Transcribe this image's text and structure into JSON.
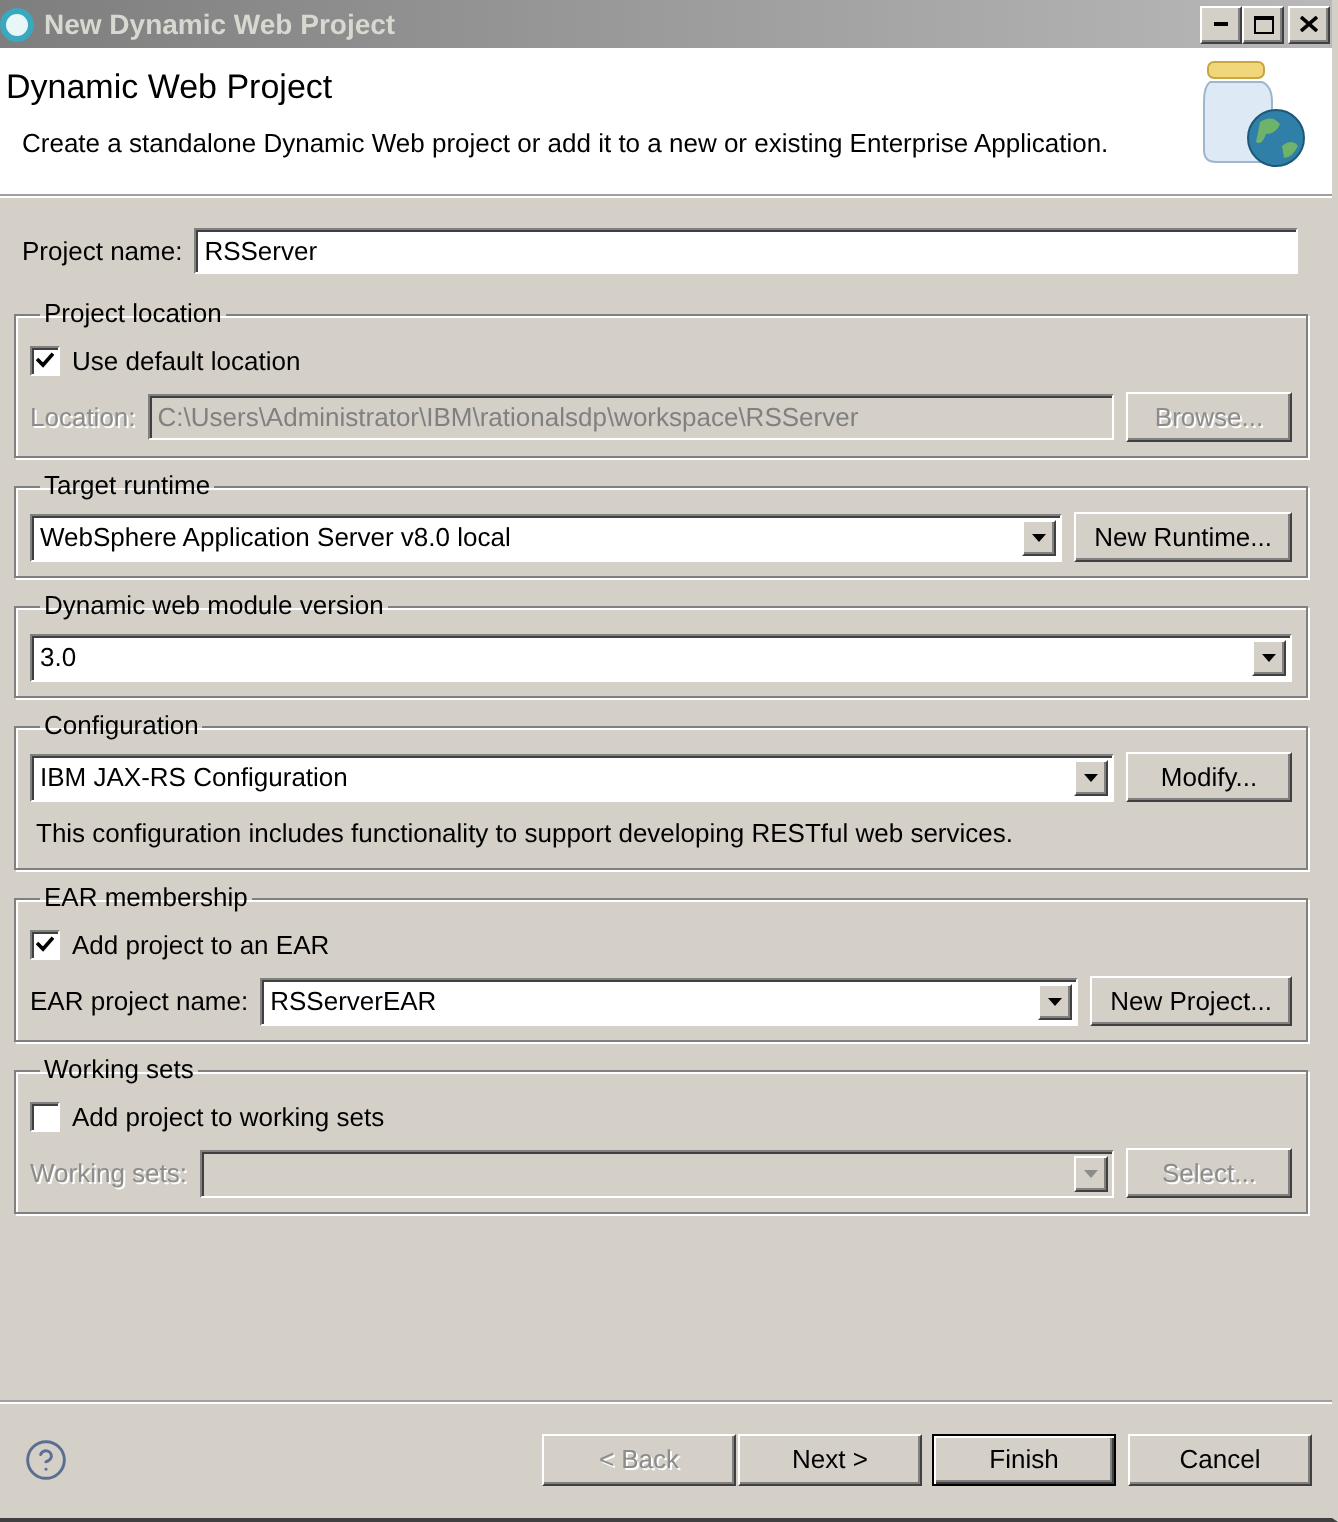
{
  "window": {
    "title": "New Dynamic Web Project"
  },
  "header": {
    "title": "Dynamic Web Project",
    "description": "Create a standalone Dynamic Web project or add it to a new or existing Enterprise Application."
  },
  "project_name": {
    "label": "Project name:",
    "value": "RSServer"
  },
  "groups": [
    {
      "legend": "Project location",
      "items": [
        {
          "kind": "checkbox",
          "label": "Use default location",
          "checked": true
        },
        {
          "kind": "text_field",
          "label": "Location:",
          "value": "C:\\Users\\Administrator\\IBM\\rationalsdp\\workspace\\RSServer",
          "disabled": true,
          "button": {
            "label": "Browse...",
            "disabled": true
          }
        }
      ]
    },
    {
      "legend": "Target runtime",
      "items": [
        {
          "kind": "combo",
          "value": "WebSphere Application Server v8.0 local",
          "disabled": false,
          "button": {
            "label": "New Runtime...",
            "disabled": false
          }
        }
      ]
    },
    {
      "legend": "Dynamic web module version",
      "items": [
        {
          "kind": "combo",
          "value": "3.0",
          "disabled": false
        }
      ]
    },
    {
      "legend": "Configuration",
      "items": [
        {
          "kind": "combo",
          "value": "IBM JAX-RS Configuration",
          "disabled": false,
          "button": {
            "label": "Modify...",
            "disabled": false
          }
        },
        {
          "kind": "note",
          "text": "This configuration includes functionality to support developing RESTful web services."
        }
      ]
    },
    {
      "legend": "EAR membership",
      "items": [
        {
          "kind": "checkbox",
          "label": "Add project to an EAR",
          "checked": true
        },
        {
          "kind": "combo",
          "label": "EAR project name:",
          "value": "RSServerEAR",
          "disabled": false,
          "button": {
            "label": "New Project...",
            "disabled": false
          }
        }
      ]
    },
    {
      "legend": "Working sets",
      "items": [
        {
          "kind": "checkbox",
          "label": "Add project to working sets",
          "checked": false
        },
        {
          "kind": "combo",
          "label": "Working sets:",
          "disabled": true,
          "button": {
            "label": "Select...",
            "disabled": true
          }
        }
      ]
    }
  ],
  "footer": {
    "buttons": [
      {
        "label": "< Back",
        "disabled": true,
        "default": false
      },
      {
        "label": "Next >",
        "disabled": false,
        "default": false
      },
      {
        "label": "Finish",
        "disabled": false,
        "default": true
      },
      {
        "label": "Cancel",
        "disabled": false,
        "default": false
      }
    ]
  }
}
